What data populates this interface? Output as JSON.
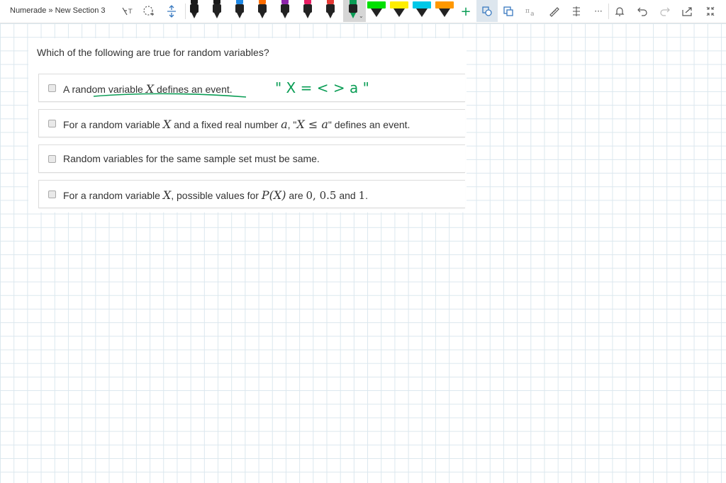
{
  "toolbar": {
    "breadcrumb": "Numerade » New Section 3",
    "icons": [
      "lasso-text-icon",
      "lasso-select-icon",
      "insert-space-icon",
      "pen-black",
      "pen-black",
      "pen-blue",
      "pen-orange",
      "pen-purple",
      "pen-pink",
      "pen-red",
      "pen-green-selected",
      "highlighter-green",
      "highlighter-yellow",
      "highlighter-cyan",
      "highlighter-orange",
      "add-pen-icon",
      "ink-to-shape-icon",
      "ink-to-text-icon",
      "ink-to-math-icon",
      "ruler-icon",
      "replay-icon",
      "more-icon",
      "bell-icon",
      "undo-icon",
      "redo-icon",
      "share-icon",
      "fullscreen-icon"
    ],
    "add_glyph": "+",
    "more_glyph": "···"
  },
  "colors": {
    "pen_black": "#1a1a1a",
    "pen_blue": "#1e88e5",
    "pen_orange": "#ff6d00",
    "pen_purple": "#8e24aa",
    "pen_pink": "#e91e63",
    "pen_red": "#e53935",
    "pen_green": "#0a9d55",
    "hl_green": "#00e000",
    "hl_yellow": "#ffee00",
    "hl_cyan": "#00c8e8",
    "hl_orange": "#ff9800",
    "ink_green": "#0a9d55"
  },
  "question": {
    "prompt": "Which of the following are true for random variables?",
    "options": [
      {
        "pre": "A random variable ",
        "var": "X",
        "post": " defines an event."
      },
      {
        "pre": "For a random variable ",
        "var": "X",
        "mid": " and a fixed real number ",
        "var2": "a",
        "mid2": ", \"",
        "expr": "X ≤ a",
        "post": "\" defines an event."
      },
      {
        "pre": "Random variables for the same sample set must be same."
      },
      {
        "pre": "For a random variable ",
        "var": "X",
        "mid": ", possible values for ",
        "expr": "P(X)",
        "mid2": " are ",
        "vals": "0, 0.5",
        "mid3": " and ",
        "val2": "1",
        "post": "."
      }
    ]
  },
  "handwriting": {
    "annotation": "\" X = < > a \""
  }
}
